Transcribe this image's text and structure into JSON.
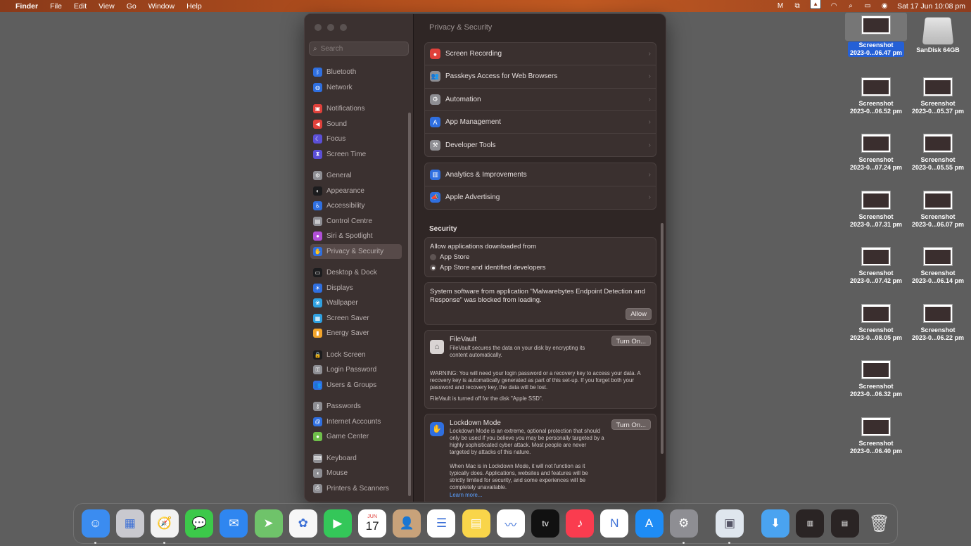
{
  "menubar": {
    "apple": "",
    "items": [
      "Finder",
      "File",
      "Edit",
      "View",
      "Go",
      "Window",
      "Help"
    ],
    "clock": "Sat 17 Jun  10:08 pm"
  },
  "window": {
    "title": "Privacy & Security",
    "search_placeholder": "Search",
    "sidebar": [
      {
        "label": "Bluetooth",
        "icon": "bluetooth-icon",
        "color": "#2f6fe0",
        "glyph": "ᛒ"
      },
      {
        "label": "Network",
        "icon": "globe-icon",
        "color": "#2f6fe0",
        "glyph": "◍"
      },
      {
        "gap": true
      },
      {
        "label": "Notifications",
        "icon": "bell-icon",
        "color": "#e0413b",
        "glyph": "▣"
      },
      {
        "label": "Sound",
        "icon": "speaker-icon",
        "color": "#e0413b",
        "glyph": "◀"
      },
      {
        "label": "Focus",
        "icon": "moon-icon",
        "color": "#5b4fd6",
        "glyph": "☾"
      },
      {
        "label": "Screen Time",
        "icon": "hourglass-icon",
        "color": "#5b4fd6",
        "glyph": "⧗"
      },
      {
        "gap": true
      },
      {
        "label": "General",
        "icon": "gear-icon",
        "color": "#8e8e93",
        "glyph": "⚙"
      },
      {
        "label": "Appearance",
        "icon": "appearance-icon",
        "color": "#1c1c1e",
        "glyph": "◐"
      },
      {
        "label": "Accessibility",
        "icon": "accessibility-icon",
        "color": "#2f6fe0",
        "glyph": "♿"
      },
      {
        "label": "Control Centre",
        "icon": "control-centre-icon",
        "color": "#8e8e93",
        "glyph": "▤"
      },
      {
        "label": "Siri & Spotlight",
        "icon": "siri-icon",
        "color": "#b04fd6",
        "glyph": "●"
      },
      {
        "label": "Privacy & Security",
        "icon": "hand-icon",
        "color": "#2f6fe0",
        "glyph": "✋",
        "selected": true
      },
      {
        "gap": true
      },
      {
        "label": "Desktop & Dock",
        "icon": "dock-icon",
        "color": "#1c1c1e",
        "glyph": "▭"
      },
      {
        "label": "Displays",
        "icon": "display-icon",
        "color": "#2f6fe0",
        "glyph": "☀"
      },
      {
        "label": "Wallpaper",
        "icon": "wallpaper-icon",
        "color": "#2fa0e0",
        "glyph": "❀"
      },
      {
        "label": "Screen Saver",
        "icon": "screen-saver-icon",
        "color": "#2fa0e0",
        "glyph": "▦"
      },
      {
        "label": "Energy Saver",
        "icon": "battery-icon",
        "color": "#f2a42b",
        "glyph": "▮"
      },
      {
        "gap": true
      },
      {
        "label": "Lock Screen",
        "icon": "lock-icon",
        "color": "#1c1c1e",
        "glyph": "🔒"
      },
      {
        "label": "Login Password",
        "icon": "key-icon",
        "color": "#8e8e93",
        "glyph": "⚿"
      },
      {
        "label": "Users & Groups",
        "icon": "users-icon",
        "color": "#2f6fe0",
        "glyph": "👥"
      },
      {
        "gap": true
      },
      {
        "label": "Passwords",
        "icon": "key-icon",
        "color": "#8e8e93",
        "glyph": "⚷"
      },
      {
        "label": "Internet Accounts",
        "icon": "at-icon",
        "color": "#2f6fe0",
        "glyph": "@"
      },
      {
        "label": "Game Center",
        "icon": "game-center-icon",
        "color": "#6fbf4a",
        "glyph": "●"
      },
      {
        "gap": true
      },
      {
        "label": "Keyboard",
        "icon": "keyboard-icon",
        "color": "#8e8e93",
        "glyph": "⌨"
      },
      {
        "label": "Mouse",
        "icon": "mouse-icon",
        "color": "#8e8e93",
        "glyph": "◖"
      },
      {
        "label": "Printers & Scanners",
        "icon": "printer-icon",
        "color": "#8e8e93",
        "glyph": "⎙"
      }
    ],
    "privacy_rows": [
      {
        "label": "Screen Recording",
        "icon": "screen-recording-icon",
        "color": "#e0413b",
        "glyph": "●"
      },
      {
        "label": "Passkeys Access for Web Browsers",
        "icon": "passkeys-icon",
        "color": "#8e8e93",
        "glyph": "👥"
      },
      {
        "label": "Automation",
        "icon": "gear-icon",
        "color": "#8e8e93",
        "glyph": "⚙"
      },
      {
        "label": "App Management",
        "icon": "app-store-icon",
        "color": "#2f6fe0",
        "glyph": "A"
      },
      {
        "label": "Developer Tools",
        "icon": "hammer-icon",
        "color": "#8e8e93",
        "glyph": "⚒"
      }
    ],
    "analytics_rows": [
      {
        "label": "Analytics & Improvements",
        "icon": "chart-icon",
        "color": "#2f6fe0",
        "glyph": "▥"
      },
      {
        "label": "Apple Advertising",
        "icon": "megaphone-icon",
        "color": "#2f6fe0",
        "glyph": "📣"
      }
    ],
    "security": {
      "title": "Security",
      "allow_label": "Allow applications downloaded from",
      "option1": "App Store",
      "option2": "App Store and identified developers",
      "blocked_text": "System software from application \"Malwarebytes Endpoint Detection and Response\" was blocked from loading.",
      "allow_button": "Allow",
      "filevault_title": "FileVault",
      "filevault_desc": "FileVault secures the data on your disk by encrypting its content automatically.",
      "filevault_button": "Turn On...",
      "filevault_warning": "WARNING: You will need your login password or a recovery key to access your data. A recovery key is automatically generated as part of this set-up. If you forget both your password and recovery key, the data will be lost.",
      "filevault_status": "FileVault is turned off for the disk \"Apple SSD\".",
      "lockdown_title": "Lockdown Mode",
      "lockdown_desc": "Lockdown Mode is an extreme, optional protection that should only be used if you believe you may be personally targeted by a highly sophisticated cyber attack. Most people are never targeted by attacks of this nature.",
      "lockdown_desc2": "When Mac is in Lockdown Mode, it will not function as it typically does. Applications, websites and features will be strictly limited for security, and some experiences will be completely unavailable.",
      "lockdown_link": "Learn more...",
      "lockdown_button": "Turn On..."
    }
  },
  "desktop": {
    "icons": [
      {
        "l1": "Screenshot",
        "l2": "2023-0...06.47 pm",
        "selected": true
      },
      {
        "l1": "SanDisk 64GB",
        "l2": "",
        "disk": true
      },
      {
        "l1": "Screenshot",
        "l2": "2023-0...06.52 pm"
      },
      {
        "l1": "Screenshot",
        "l2": "2023-0...05.37 pm"
      },
      {
        "l1": "Screenshot",
        "l2": "2023-0...07.24 pm"
      },
      {
        "l1": "Screenshot",
        "l2": "2023-0...05.55 pm"
      },
      {
        "l1": "Screenshot",
        "l2": "2023-0...07.31 pm"
      },
      {
        "l1": "Screenshot",
        "l2": "2023-0...06.07 pm"
      },
      {
        "l1": "Screenshot",
        "l2": "2023-0...07.42 pm"
      },
      {
        "l1": "Screenshot",
        "l2": "2023-0...06.14 pm"
      },
      {
        "l1": "Screenshot",
        "l2": "2023-0...08.05 pm"
      },
      {
        "l1": "Screenshot",
        "l2": "2023-0...06.22 pm"
      },
      {
        "l1": "Screenshot",
        "l2": "2023-0...06.32 pm"
      },
      {
        "l1": "Screenshot",
        "l2": "2023-0...06.40 pm"
      }
    ]
  },
  "dock": {
    "calendar_month": "JUN",
    "calendar_day": "17",
    "tv_label": "tv",
    "apps": [
      {
        "name": "finder-icon",
        "bg": "#3b8cf0",
        "glyph": "☺",
        "dot": true
      },
      {
        "name": "launchpad-icon",
        "bg": "#c9c9cf",
        "glyph": "▦"
      },
      {
        "name": "safari-icon",
        "bg": "#f2f2f2",
        "glyph": "🧭",
        "dot": true
      },
      {
        "name": "messages-icon",
        "bg": "#3cc94a",
        "glyph": "💬"
      },
      {
        "name": "mail-icon",
        "bg": "#2f86f0",
        "glyph": "✉"
      },
      {
        "name": "maps-icon",
        "bg": "#6fc36a",
        "glyph": "➤"
      },
      {
        "name": "photos-icon",
        "bg": "#f7f7f7",
        "glyph": "✿"
      },
      {
        "name": "facetime-icon",
        "bg": "#34c759",
        "glyph": "▶"
      },
      {
        "name": "calendar-icon",
        "bg": "#ffffff",
        "glyph": "cal"
      },
      {
        "name": "contacts-icon",
        "bg": "#c8a27a",
        "glyph": "👤"
      },
      {
        "name": "reminders-icon",
        "bg": "#ffffff",
        "glyph": "☰"
      },
      {
        "name": "notes-icon",
        "bg": "#f9d54a",
        "glyph": "▤"
      },
      {
        "name": "freeform-icon",
        "bg": "#ffffff",
        "glyph": "〰"
      },
      {
        "name": "apple-tv-icon",
        "bg": "#111111",
        "glyph": "tv"
      },
      {
        "name": "music-icon",
        "bg": "#fa3c4f",
        "glyph": "♪"
      },
      {
        "name": "news-icon",
        "bg": "#ffffff",
        "glyph": "N"
      },
      {
        "name": "app-store-icon",
        "bg": "#1e8cf5",
        "glyph": "A"
      },
      {
        "name": "system-settings-icon",
        "bg": "#8e8e93",
        "glyph": "⚙",
        "dot": true
      }
    ]
  }
}
